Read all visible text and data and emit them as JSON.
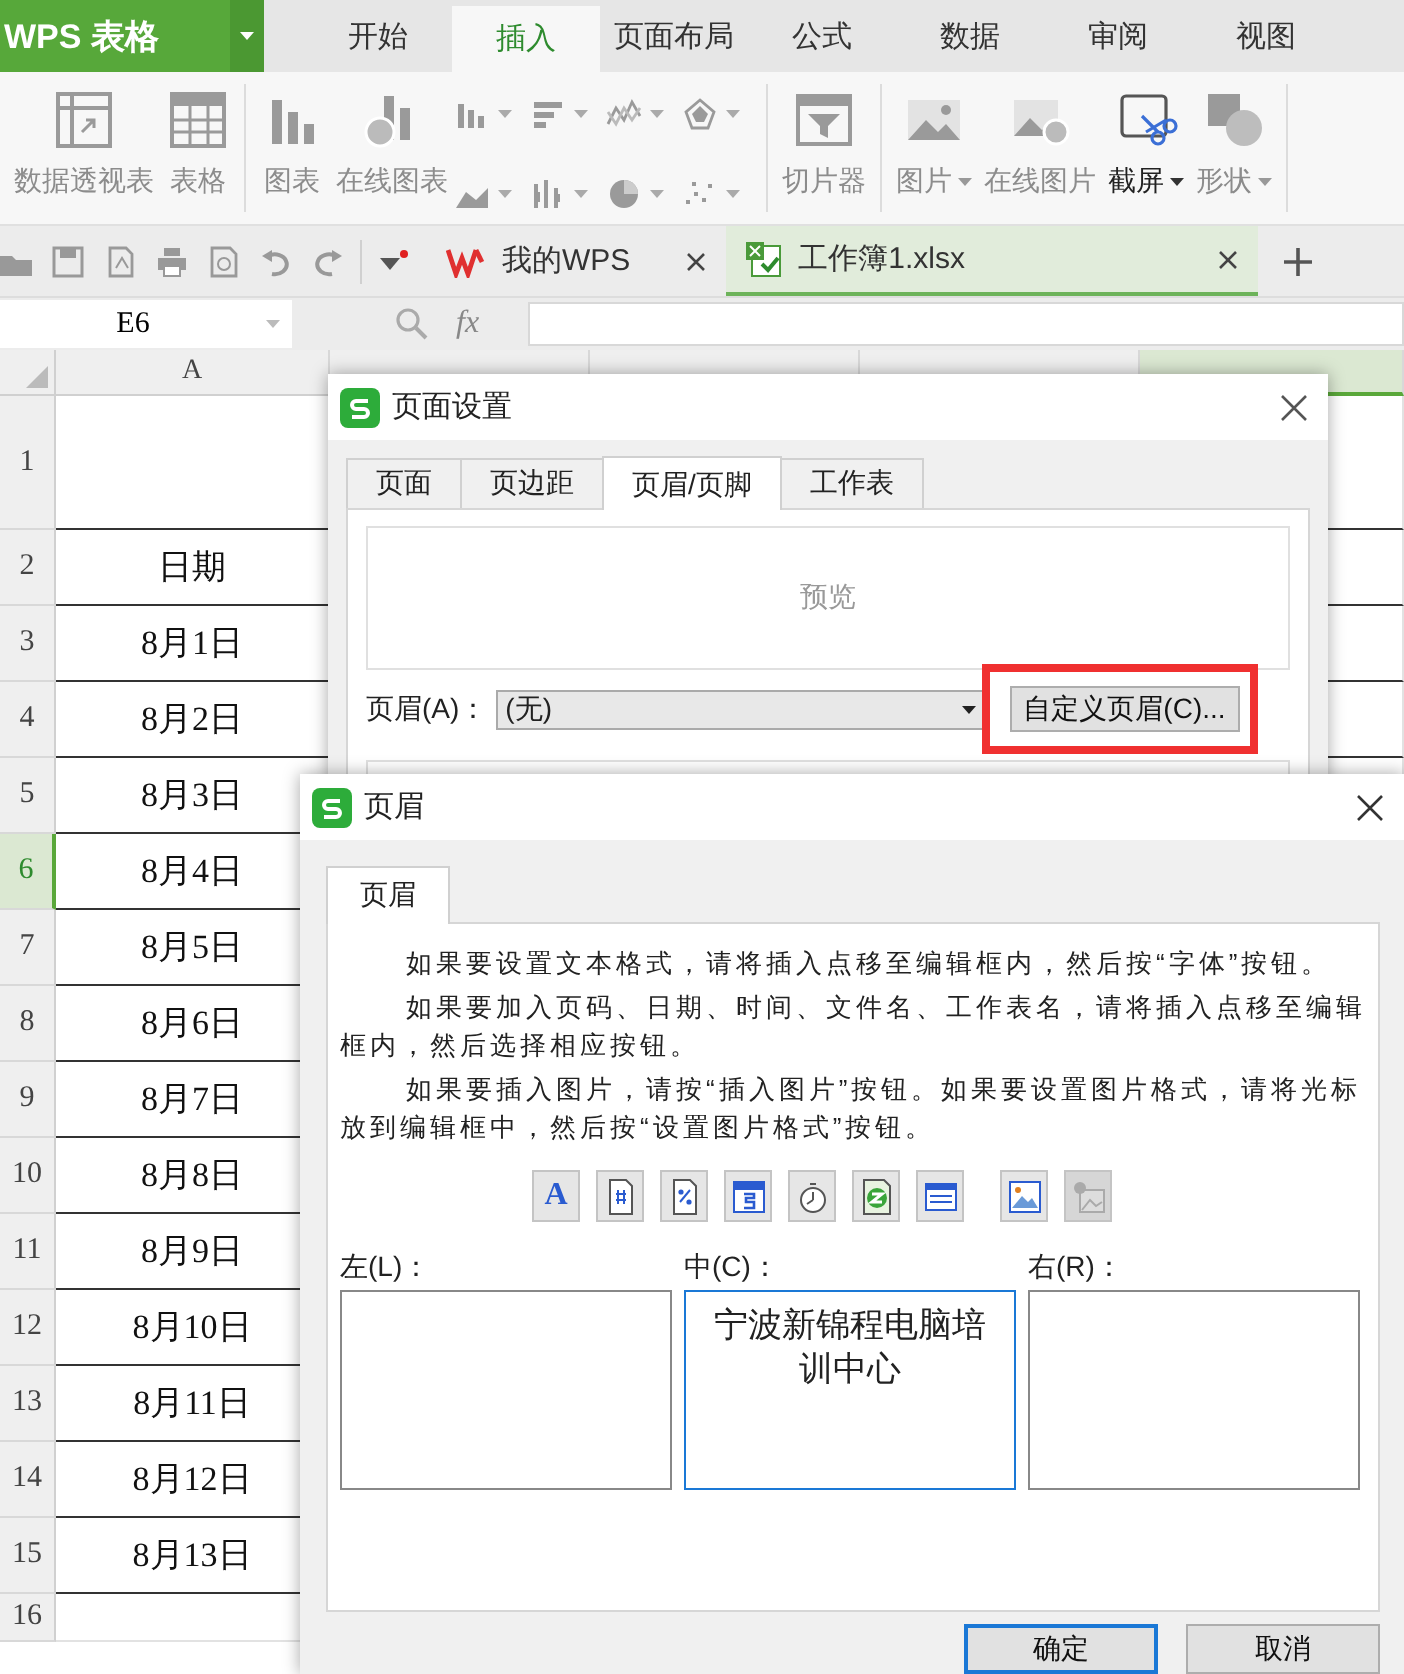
{
  "app": {
    "name": "WPS 表格"
  },
  "ribbon_tabs": [
    {
      "label": "开始",
      "selected": false
    },
    {
      "label": "插入",
      "selected": true
    },
    {
      "label": "页面布局",
      "selected": false
    },
    {
      "label": "公式",
      "selected": false
    },
    {
      "label": "数据",
      "selected": false
    },
    {
      "label": "审阅",
      "selected": false
    },
    {
      "label": "视图",
      "selected": false
    }
  ],
  "ribbon_groups": [
    {
      "buttons": [
        {
          "kind": "pivot",
          "label": "数据透视表",
          "dropdown": false,
          "disabled": true
        },
        {
          "kind": "table",
          "label": "表格",
          "dropdown": false,
          "disabled": true
        }
      ]
    },
    {
      "buttons": [
        {
          "kind": "chart",
          "label": "图表",
          "dropdown": false,
          "disabled": true
        },
        {
          "kind": "online-chart",
          "label": "在线图表",
          "dropdown": false,
          "disabled": true
        }
      ],
      "mini_charts": [
        {
          "kind": "column"
        },
        {
          "kind": "bar"
        },
        {
          "kind": "line"
        },
        {
          "kind": "radar"
        },
        {
          "kind": "area"
        },
        {
          "kind": "stock"
        },
        {
          "kind": "pie"
        },
        {
          "kind": "scatter"
        }
      ]
    },
    {
      "buttons": [
        {
          "kind": "slicer",
          "label": "切片器",
          "dropdown": false,
          "disabled": true
        }
      ]
    },
    {
      "buttons": [
        {
          "kind": "picture",
          "label": "图片",
          "dropdown": true,
          "disabled": true
        },
        {
          "kind": "online-picture",
          "label": "在线图片",
          "dropdown": false,
          "disabled": true
        },
        {
          "kind": "screenshot",
          "label": "截屏",
          "dropdown": true,
          "disabled": false
        },
        {
          "kind": "shape",
          "label": "形状",
          "dropdown": true,
          "disabled": true
        }
      ]
    }
  ],
  "doc_tabs": [
    {
      "kind": "home",
      "label": "我的WPS",
      "selected": false
    },
    {
      "kind": "workbook",
      "label": "工作簿1.xlsx",
      "selected": true
    }
  ],
  "formula_bar": {
    "name_box": "E6",
    "function_label": "fx"
  },
  "sheet": {
    "columns": [
      {
        "label": "A",
        "selected": false
      },
      {
        "selected": false
      },
      {
        "selected": false
      },
      {
        "selected": false
      },
      {
        "selected": true
      }
    ],
    "rows": [
      {
        "number": "1",
        "selected": false
      },
      {
        "number": "2",
        "value": "日期",
        "selected": false
      },
      {
        "number": "3",
        "value": "8月1日",
        "selected": false
      },
      {
        "number": "4",
        "value": "8月2日",
        "selected": false
      },
      {
        "number": "5",
        "value": "8月3日",
        "selected": false
      },
      {
        "number": "6",
        "value": "8月4日",
        "selected": true
      },
      {
        "number": "7",
        "value": "8月5日",
        "selected": false
      },
      {
        "number": "8",
        "value": "8月6日",
        "selected": false
      },
      {
        "number": "9",
        "value": "8月7日",
        "selected": false
      },
      {
        "number": "10",
        "value": "8月8日",
        "selected": false
      },
      {
        "number": "11",
        "value": "8月9日",
        "selected": false
      },
      {
        "number": "12",
        "value": "8月10日",
        "selected": false
      },
      {
        "number": "13",
        "value": "8月11日",
        "selected": false
      },
      {
        "number": "14",
        "value": "8月12日",
        "selected": false
      },
      {
        "number": "15",
        "value": "8月13日",
        "selected": false
      },
      {
        "number": "16",
        "selected": false
      }
    ]
  },
  "page_setup_dialog": {
    "title": "页面设置",
    "tabs": [
      {
        "label": "页面",
        "selected": false
      },
      {
        "label": "页边距",
        "selected": false
      },
      {
        "label": "页眉/页脚",
        "selected": true
      },
      {
        "label": "工作表",
        "selected": false
      }
    ],
    "preview": "预览",
    "header_label": "页眉(A)：",
    "header_value": "(无)",
    "custom_button": {
      "label": "自定义页眉(C)...",
      "highlighted": true
    }
  },
  "header_dialog": {
    "title": "页眉",
    "tabs": [
      {
        "label": "页眉",
        "selected": true
      }
    ],
    "paragraphs": [
      "如果要设置文本格式，请将插入点移至编辑框内，然后按“字体”按钮。",
      "如果要加入页码、日期、时间、文件名、工作表名，请将插入点移至编辑框内，然后选择相应按钮。",
      "如果要插入图片，请按“插入图片”按钮。如果要设置图片格式，请将光标放到编辑框中，然后按“设置图片格式”按钮。"
    ],
    "tools": [
      {
        "kind": "font",
        "label": "A",
        "disabled": false
      },
      {
        "kind": "page-number",
        "disabled": false
      },
      {
        "kind": "page-count",
        "disabled": false
      },
      {
        "kind": "date",
        "disabled": false
      },
      {
        "kind": "time",
        "disabled": false
      },
      {
        "kind": "file-name",
        "disabled": false
      },
      {
        "kind": "sheet-name",
        "disabled": false
      },
      {
        "kind": "picture",
        "disabled": false
      },
      {
        "kind": "picture-format",
        "disabled": true
      }
    ],
    "sections": [
      {
        "label": "左(L)：",
        "focused": false
      },
      {
        "label": "中(C)：",
        "text": "宁波新锦程电脑培训中心",
        "focused": true
      },
      {
        "label": "右(R)：",
        "focused": false
      }
    ],
    "buttons": [
      {
        "label": "确定",
        "default": true
      },
      {
        "label": "取消",
        "default": false
      }
    ]
  }
}
